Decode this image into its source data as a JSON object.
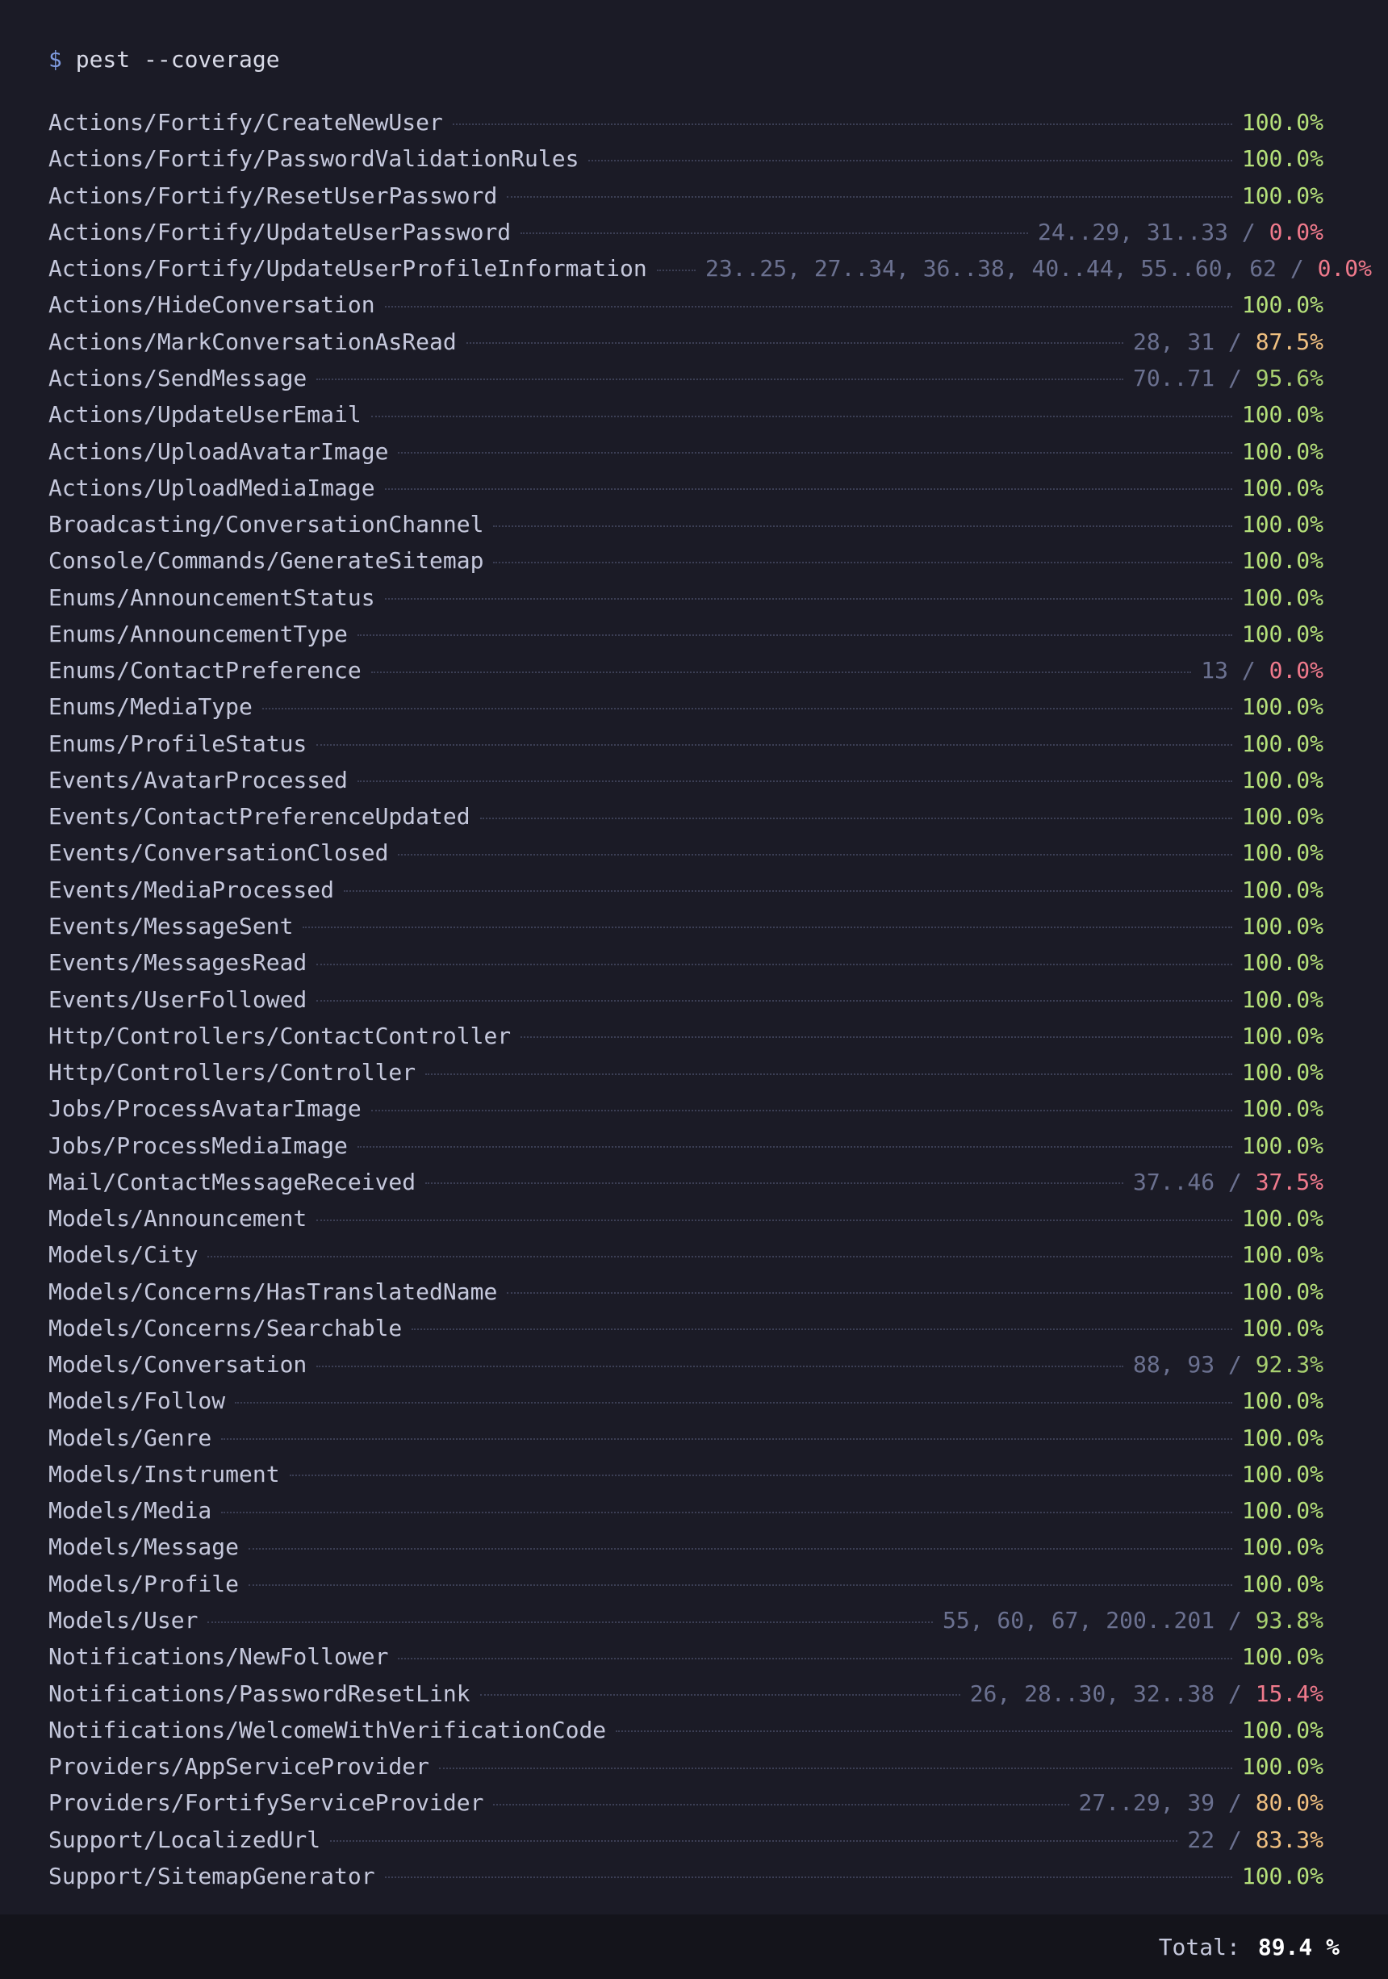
{
  "prompt": {
    "symbol": "$",
    "command": "pest --coverage"
  },
  "colors": {
    "full": "#b5e07a",
    "high": "#a8d070",
    "mid": "#f0c080",
    "low": "#f07a8c",
    "lines": "#6b7190"
  },
  "rows": [
    {
      "name": "Actions/Fortify/CreateNewUser",
      "lines": "",
      "percent": "100.0%",
      "level": "full"
    },
    {
      "name": "Actions/Fortify/PasswordValidationRules",
      "lines": "",
      "percent": "100.0%",
      "level": "full"
    },
    {
      "name": "Actions/Fortify/ResetUserPassword",
      "lines": "",
      "percent": "100.0%",
      "level": "full"
    },
    {
      "name": "Actions/Fortify/UpdateUserPassword",
      "lines": "24..29, 31..33",
      "percent": "0.0%",
      "level": "low"
    },
    {
      "name": "Actions/Fortify/UpdateUserProfileInformation",
      "lines": "23..25, 27..34, 36..38, 40..44, 55..60, 62",
      "percent": "0.0%",
      "level": "low",
      "wide": true
    },
    {
      "name": "Actions/HideConversation",
      "lines": "",
      "percent": "100.0%",
      "level": "full"
    },
    {
      "name": "Actions/MarkConversationAsRead",
      "lines": "28, 31",
      "percent": "87.5%",
      "level": "mid"
    },
    {
      "name": "Actions/SendMessage",
      "lines": "70..71",
      "percent": "95.6%",
      "level": "high"
    },
    {
      "name": "Actions/UpdateUserEmail",
      "lines": "",
      "percent": "100.0%",
      "level": "full"
    },
    {
      "name": "Actions/UploadAvatarImage",
      "lines": "",
      "percent": "100.0%",
      "level": "full"
    },
    {
      "name": "Actions/UploadMediaImage",
      "lines": "",
      "percent": "100.0%",
      "level": "full"
    },
    {
      "name": "Broadcasting/ConversationChannel",
      "lines": "",
      "percent": "100.0%",
      "level": "full"
    },
    {
      "name": "Console/Commands/GenerateSitemap",
      "lines": "",
      "percent": "100.0%",
      "level": "full"
    },
    {
      "name": "Enums/AnnouncementStatus",
      "lines": "",
      "percent": "100.0%",
      "level": "full"
    },
    {
      "name": "Enums/AnnouncementType",
      "lines": "",
      "percent": "100.0%",
      "level": "full"
    },
    {
      "name": "Enums/ContactPreference",
      "lines": "13",
      "percent": "0.0%",
      "level": "low"
    },
    {
      "name": "Enums/MediaType",
      "lines": "",
      "percent": "100.0%",
      "level": "full"
    },
    {
      "name": "Enums/ProfileStatus",
      "lines": "",
      "percent": "100.0%",
      "level": "full"
    },
    {
      "name": "Events/AvatarProcessed",
      "lines": "",
      "percent": "100.0%",
      "level": "full"
    },
    {
      "name": "Events/ContactPreferenceUpdated",
      "lines": "",
      "percent": "100.0%",
      "level": "full"
    },
    {
      "name": "Events/ConversationClosed",
      "lines": "",
      "percent": "100.0%",
      "level": "full"
    },
    {
      "name": "Events/MediaProcessed",
      "lines": "",
      "percent": "100.0%",
      "level": "full"
    },
    {
      "name": "Events/MessageSent",
      "lines": "",
      "percent": "100.0%",
      "level": "full"
    },
    {
      "name": "Events/MessagesRead",
      "lines": "",
      "percent": "100.0%",
      "level": "full"
    },
    {
      "name": "Events/UserFollowed",
      "lines": "",
      "percent": "100.0%",
      "level": "full"
    },
    {
      "name": "Http/Controllers/ContactController",
      "lines": "",
      "percent": "100.0%",
      "level": "full"
    },
    {
      "name": "Http/Controllers/Controller",
      "lines": "",
      "percent": "100.0%",
      "level": "full"
    },
    {
      "name": "Jobs/ProcessAvatarImage",
      "lines": "",
      "percent": "100.0%",
      "level": "full"
    },
    {
      "name": "Jobs/ProcessMediaImage",
      "lines": "",
      "percent": "100.0%",
      "level": "full"
    },
    {
      "name": "Mail/ContactMessageReceived",
      "lines": "37..46",
      "percent": "37.5%",
      "level": "low"
    },
    {
      "name": "Models/Announcement",
      "lines": "",
      "percent": "100.0%",
      "level": "full"
    },
    {
      "name": "Models/City",
      "lines": "",
      "percent": "100.0%",
      "level": "full"
    },
    {
      "name": "Models/Concerns/HasTranslatedName",
      "lines": "",
      "percent": "100.0%",
      "level": "full"
    },
    {
      "name": "Models/Concerns/Searchable",
      "lines": "",
      "percent": "100.0%",
      "level": "full"
    },
    {
      "name": "Models/Conversation",
      "lines": "88, 93",
      "percent": "92.3%",
      "level": "high"
    },
    {
      "name": "Models/Follow",
      "lines": "",
      "percent": "100.0%",
      "level": "full"
    },
    {
      "name": "Models/Genre",
      "lines": "",
      "percent": "100.0%",
      "level": "full"
    },
    {
      "name": "Models/Instrument",
      "lines": "",
      "percent": "100.0%",
      "level": "full"
    },
    {
      "name": "Models/Media",
      "lines": "",
      "percent": "100.0%",
      "level": "full"
    },
    {
      "name": "Models/Message",
      "lines": "",
      "percent": "100.0%",
      "level": "full"
    },
    {
      "name": "Models/Profile",
      "lines": "",
      "percent": "100.0%",
      "level": "full"
    },
    {
      "name": "Models/User",
      "lines": "55, 60, 67, 200..201",
      "percent": "93.8%",
      "level": "high"
    },
    {
      "name": "Notifications/NewFollower",
      "lines": "",
      "percent": "100.0%",
      "level": "full"
    },
    {
      "name": "Notifications/PasswordResetLink",
      "lines": "26, 28..30, 32..38",
      "percent": "15.4%",
      "level": "low"
    },
    {
      "name": "Notifications/WelcomeWithVerificationCode",
      "lines": "",
      "percent": "100.0%",
      "level": "full"
    },
    {
      "name": "Providers/AppServiceProvider",
      "lines": "",
      "percent": "100.0%",
      "level": "full"
    },
    {
      "name": "Providers/FortifyServiceProvider",
      "lines": "27..29, 39",
      "percent": "80.0%",
      "level": "mid"
    },
    {
      "name": "Support/LocalizedUrl",
      "lines": "22",
      "percent": "83.3%",
      "level": "mid"
    },
    {
      "name": "Support/SitemapGenerator",
      "lines": "",
      "percent": "100.0%",
      "level": "full"
    }
  ],
  "footer": {
    "total_label": "Total:",
    "total_value": "89.4 %"
  }
}
